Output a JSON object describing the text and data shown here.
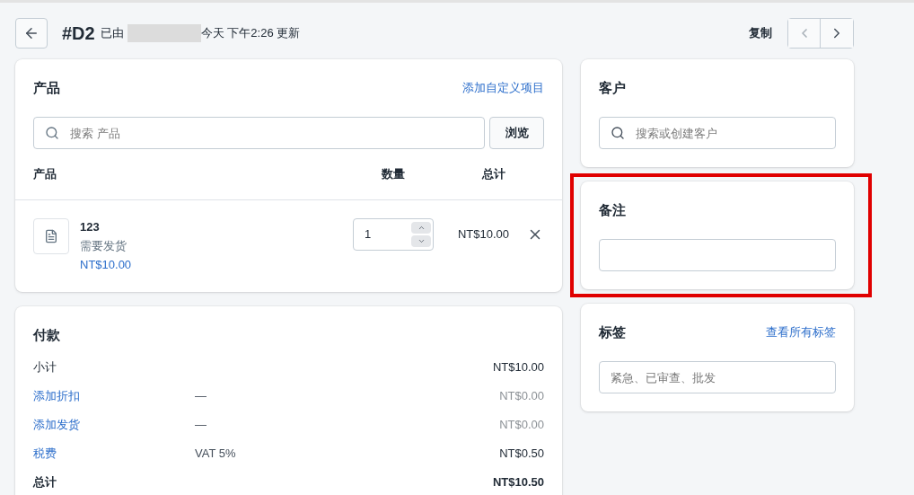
{
  "header": {
    "order_number": "#D2",
    "updated_prefix": "已由",
    "updated_suffix": "今天 下午2:26 更新",
    "duplicate": "复制",
    "prev": {
      "disabled": true
    },
    "next": {
      "disabled": false
    }
  },
  "products": {
    "title": "产品",
    "add_custom": "添加自定义项目",
    "search": {
      "placeholder": "搜索 产品"
    },
    "browse": "浏览",
    "columns": [
      "产品",
      "数量",
      "总计"
    ],
    "items": [
      {
        "name": "123",
        "note": "需要发货",
        "price": "NT$10.00",
        "quantity": "1",
        "total": "NT$10.00"
      }
    ]
  },
  "payment": {
    "title": "付款",
    "rows": [
      {
        "label": "小计",
        "kind": "text",
        "detail": "",
        "amount": "NT$10.00",
        "muted": false,
        "bold": false
      },
      {
        "label": "添加折扣",
        "kind": "link",
        "detail": "—",
        "amount": "NT$0.00",
        "muted": true,
        "bold": false
      },
      {
        "label": "添加发货",
        "kind": "link",
        "detail": "—",
        "amount": "NT$0.00",
        "muted": true,
        "bold": false
      },
      {
        "label": "税费",
        "kind": "link",
        "detail": "VAT 5%",
        "amount": "NT$0.50",
        "muted": false,
        "bold": false
      },
      {
        "label": "总计",
        "kind": "text",
        "detail": "",
        "amount": "NT$10.50",
        "muted": false,
        "bold": true
      }
    ]
  },
  "customer": {
    "title": "客户",
    "search": {
      "placeholder": "搜索或创建客户"
    }
  },
  "notes": {
    "title": "备注",
    "highlighted": true
  },
  "tags": {
    "title": "标签",
    "view_all": "查看所有标签",
    "input": {
      "placeholder": "紧急、已审查、批发"
    }
  }
}
